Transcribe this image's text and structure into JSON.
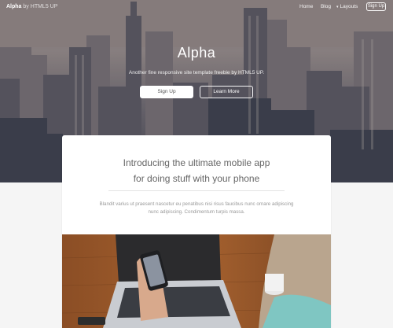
{
  "nav": {
    "brand_name": "Alpha",
    "brand_by": "by",
    "brand_author": "HTML5 UP",
    "links": [
      {
        "label": "Home"
      },
      {
        "label": "Blog"
      },
      {
        "label": "Layouts"
      }
    ],
    "signup_label": "Sign Up"
  },
  "hero": {
    "title": "Alpha",
    "subtitle": "Another fine responsive site template freebie by HTML5 UP.",
    "primary_button": "Sign Up",
    "secondary_button": "Learn More"
  },
  "card": {
    "heading_line1": "Introducing the ultimate mobile app",
    "heading_line2": "for doing stuff with your phone",
    "body": "Blandit varius ut praesent nascetur eu penatibus nisi risus faucibus nunc ornare adipiscing nunc adipiscing. Condimentum turpis massa."
  },
  "colors": {
    "hero_overlay": "#8e8384",
    "page_background": "#f5f5f5",
    "card_background": "#ffffff",
    "heading_text": "#666666",
    "body_text": "#9a9a9a"
  },
  "icons": {
    "layouts_dropdown": "chevron-down-icon"
  }
}
